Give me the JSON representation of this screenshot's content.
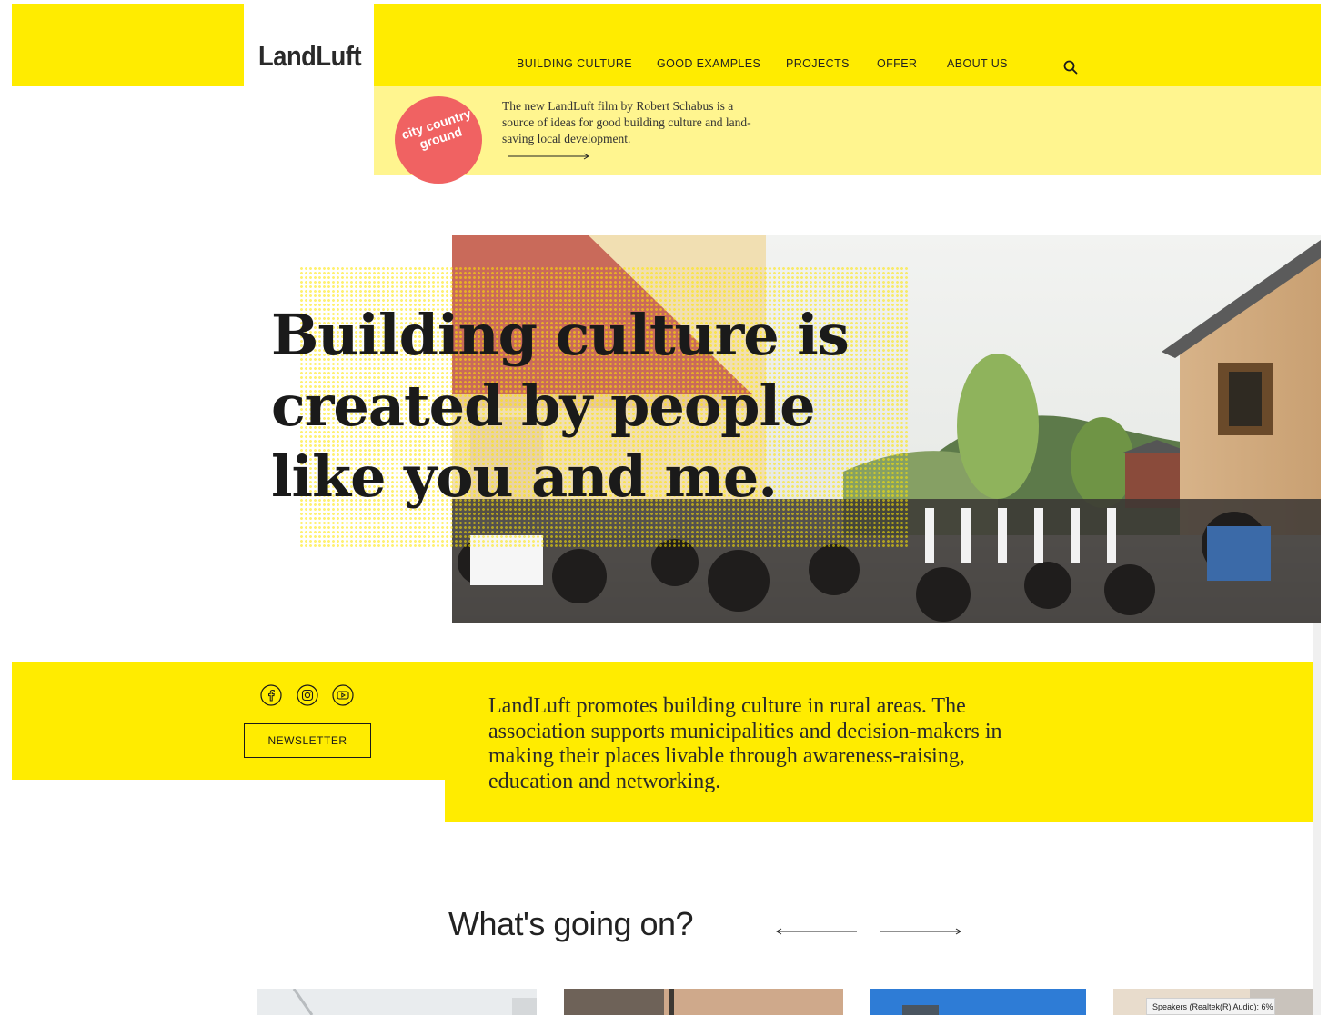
{
  "brand": {
    "logo": "LandLuft"
  },
  "nav": {
    "items": [
      {
        "label": "BUILDING CULTURE"
      },
      {
        "label": "GOOD EXAMPLES"
      },
      {
        "label": "PROJECTS"
      },
      {
        "label": "OFFER"
      },
      {
        "label": "ABOUT US"
      }
    ],
    "search_icon": "search-icon"
  },
  "promo": {
    "badge_line1": "city country",
    "badge_line2": "ground",
    "text": "The new LandLuft film by Robert Schabus is a source of ideas for good building culture and land-saving local development.",
    "arrow_icon": "arrow-right-icon"
  },
  "hero": {
    "title_line1": "Building culture is",
    "title_line2": "created by people",
    "title_line3": "like you and me."
  },
  "about": {
    "social_icons": [
      "facebook-icon",
      "instagram-icon",
      "youtube-icon"
    ],
    "newsletter_label": "NEWSLETTER",
    "text": "LandLuft promotes building culture in rural areas. The association supports municipalities and decision-makers in making their places livable through awareness-raising, education and networking."
  },
  "news": {
    "title": "What's going on?",
    "prev_icon": "arrow-left-icon",
    "next_icon": "arrow-right-icon"
  },
  "tooltip": {
    "text": "Speakers (Realtek(R) Audio): 6%"
  },
  "colors": {
    "yellow": "#ffec00",
    "pale_yellow": "#fff58f",
    "badge": "#f06262"
  }
}
